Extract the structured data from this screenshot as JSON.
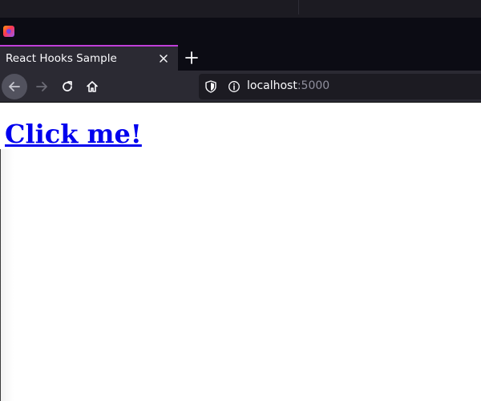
{
  "browser": {
    "tab": {
      "title": "React Hooks Sample"
    },
    "address_bar": {
      "host": "localhost",
      "port": ":5000"
    },
    "colors": {
      "tab_accent": "#c03fd9",
      "chrome_dark": "#0c0c14",
      "toolbar": "#2b2a33",
      "link": "#0000ee"
    },
    "icons": {
      "app": "firefox-icon",
      "tab_close": "close-icon",
      "new_tab": "plus-icon",
      "back": "arrow-left-icon",
      "forward": "arrow-right-icon",
      "reload": "reload-icon",
      "home": "home-icon",
      "tracking": "shield-icon",
      "site_info": "info-icon"
    }
  },
  "page": {
    "heading_link": "Click me!"
  }
}
